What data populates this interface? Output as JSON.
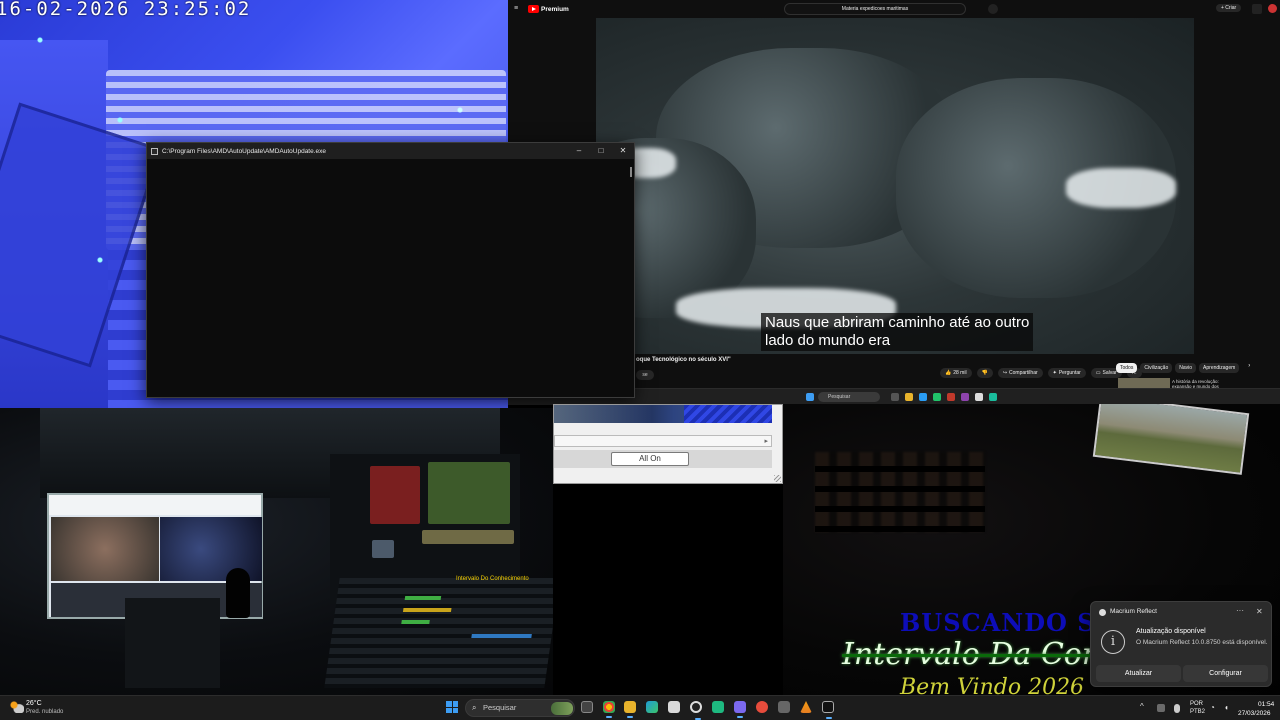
{
  "camera": {
    "timestamp": "16-02-2026 23:25:02"
  },
  "youtube": {
    "logo_label": "Premium",
    "search_query": "Materia expedicoes maritimas",
    "subtitle_line1": "Naus que abriram caminho até ao outro",
    "subtitle_line2": "lado do mundo era",
    "video_title": "oque Tecnológico no século XVI\"",
    "channel_button": "se",
    "create_label": "+ Criar",
    "actions": {
      "likes": "28 mil",
      "share": "Compartilhar",
      "ask": "Perguntar",
      "save": "Salvar"
    },
    "chips": [
      "Todos",
      "Civilização",
      "Navio",
      "Aprendizagem"
    ],
    "rec_title": "A história da revolução: expansão e mundo dos",
    "taskbar_search": "Pesquisar"
  },
  "console": {
    "title": "C:\\Program Files\\AMD\\AutoUpdate\\AMDAutoUpdate.exe",
    "minimize": "–",
    "maximize": "□",
    "close": "✕"
  },
  "studio": {
    "monitor_label": "Intervalo Do Conhecimento"
  },
  "dialog": {
    "button_label": "All On",
    "scroll_arrow": "▸"
  },
  "stream": {
    "title_text": "BUSCANDO SA",
    "interval_text": "Intervalo Da Conh",
    "welcome_text": "Bem Vindo 2026"
  },
  "notification": {
    "app_name": "Macrium Reflect",
    "more": "···",
    "close": "✕",
    "info_glyph": "i",
    "heading": "Atualização disponível",
    "body": "O Macrium Reflect 10.0.8750 está disponível.",
    "button_update": "Atualizar",
    "button_configure": "Configurar"
  },
  "taskbar": {
    "weather_temp": "26°C",
    "weather_desc": "Pred. nublado",
    "search_placeholder": "Pesquisar",
    "search_glyph": "⌕",
    "tray_chevron": "^",
    "lang_line1": "POR",
    "lang_line2": "PTB2",
    "wifi_glyph": "◔",
    "volume_glyph": "◖",
    "time": "01:54",
    "date": "27/03/2026"
  },
  "colors": {
    "accent": "#3d9df3",
    "youtube_red": "#ff0000",
    "stream_title": "#0d0db8",
    "stream_welcome": "#cfd23a"
  }
}
